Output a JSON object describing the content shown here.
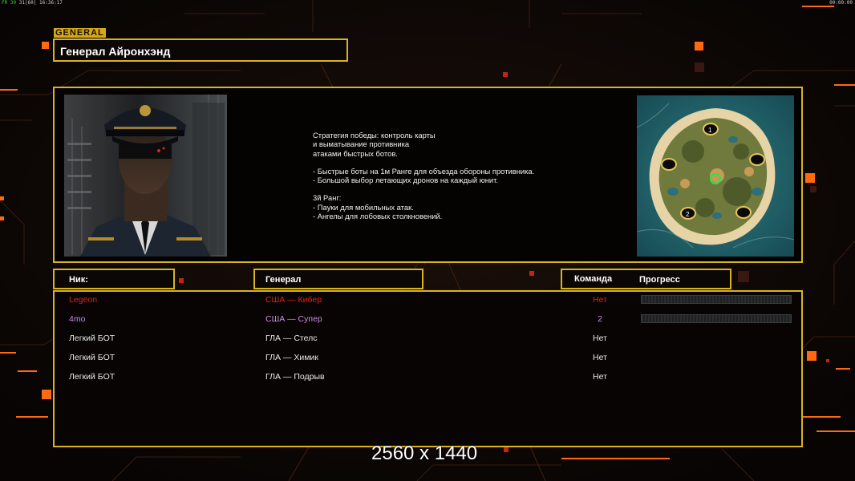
{
  "hud": {
    "fps_label": "FR",
    "fps_value": "30",
    "fps_rest": "31|60| 16:36:17",
    "timer": "00:00:00"
  },
  "general": {
    "section_tag": "GENERAL",
    "name": "Генерал Айронхэнд",
    "portrait_icon": "general-portrait",
    "map_icon": "map-preview",
    "description": [
      "Стратегия победы: контроль карты",
      "и выматывание противника",
      "атаками быстрых ботов.",
      "",
      "- Быстрые боты на 1м Ранге для объезда обороны противника.",
      "- Большой выбор летающих дронов на каждый юнит.",
      "",
      "3й Ранг:",
      "- Пауки для мобильных атак.",
      "- Ангелы для лобовых столкновений."
    ]
  },
  "map": {
    "start_positions": [
      "1",
      "2"
    ]
  },
  "table": {
    "headers": {
      "nick": "Ник:",
      "general": "Генерал",
      "team": "Команда",
      "progress": "Прогресс"
    },
    "rows": [
      {
        "nick": "Legeon",
        "general": "США — Кибер",
        "team": "Нет",
        "color": "#e0221d",
        "progress": 0
      },
      {
        "nick": "4mo",
        "general": "США — Супер",
        "team": "2",
        "color": "#c98ee6",
        "progress": 0
      },
      {
        "nick": "Легкий БОТ",
        "general": "ГЛА — Стелс",
        "team": "Нет",
        "color": "#eeeeee"
      },
      {
        "nick": "Легкий БОТ",
        "general": "ГЛА — Химик",
        "team": "Нет",
        "color": "#eeeeee"
      },
      {
        "nick": "Легкий БОТ",
        "general": "ГЛА — Подрыв",
        "team": "Нет",
        "color": "#eeeeee"
      }
    ]
  },
  "resolution_label": "2560 x 1440",
  "colors": {
    "accent_gold": "#d9b420",
    "accent_orange": "#ff6a10",
    "background": "#0c0706"
  }
}
